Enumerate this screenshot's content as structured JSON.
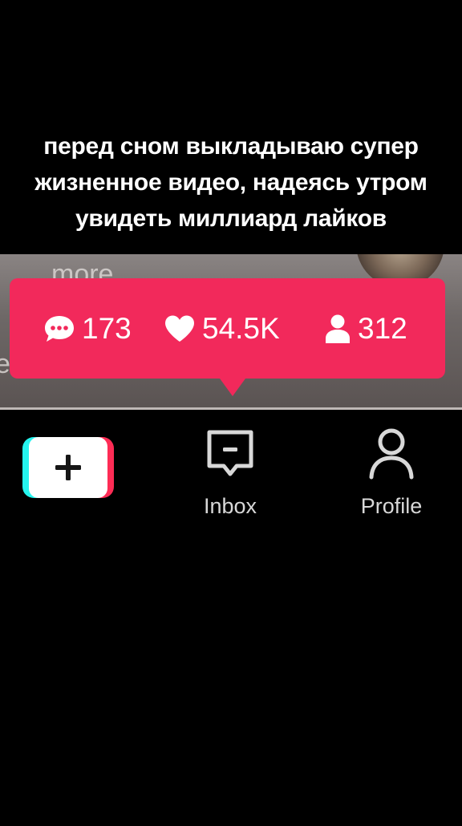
{
  "caption": {
    "line1": "перед сном выкладываю супер",
    "line2": "жизненное видео, надеясь утром",
    "line3": "увидеть миллиард лайков"
  },
  "video": {
    "background_text": "more"
  },
  "stats": {
    "comments": "173",
    "likes": "54.5K",
    "followers": "312",
    "bubble_color": "#f2295b"
  },
  "nav": {
    "inbox_label": "Inbox",
    "profile_label": "Profile",
    "create_icon": "plus-icon",
    "accent_cyan": "#25f4ee",
    "accent_pink": "#fe2c55"
  }
}
